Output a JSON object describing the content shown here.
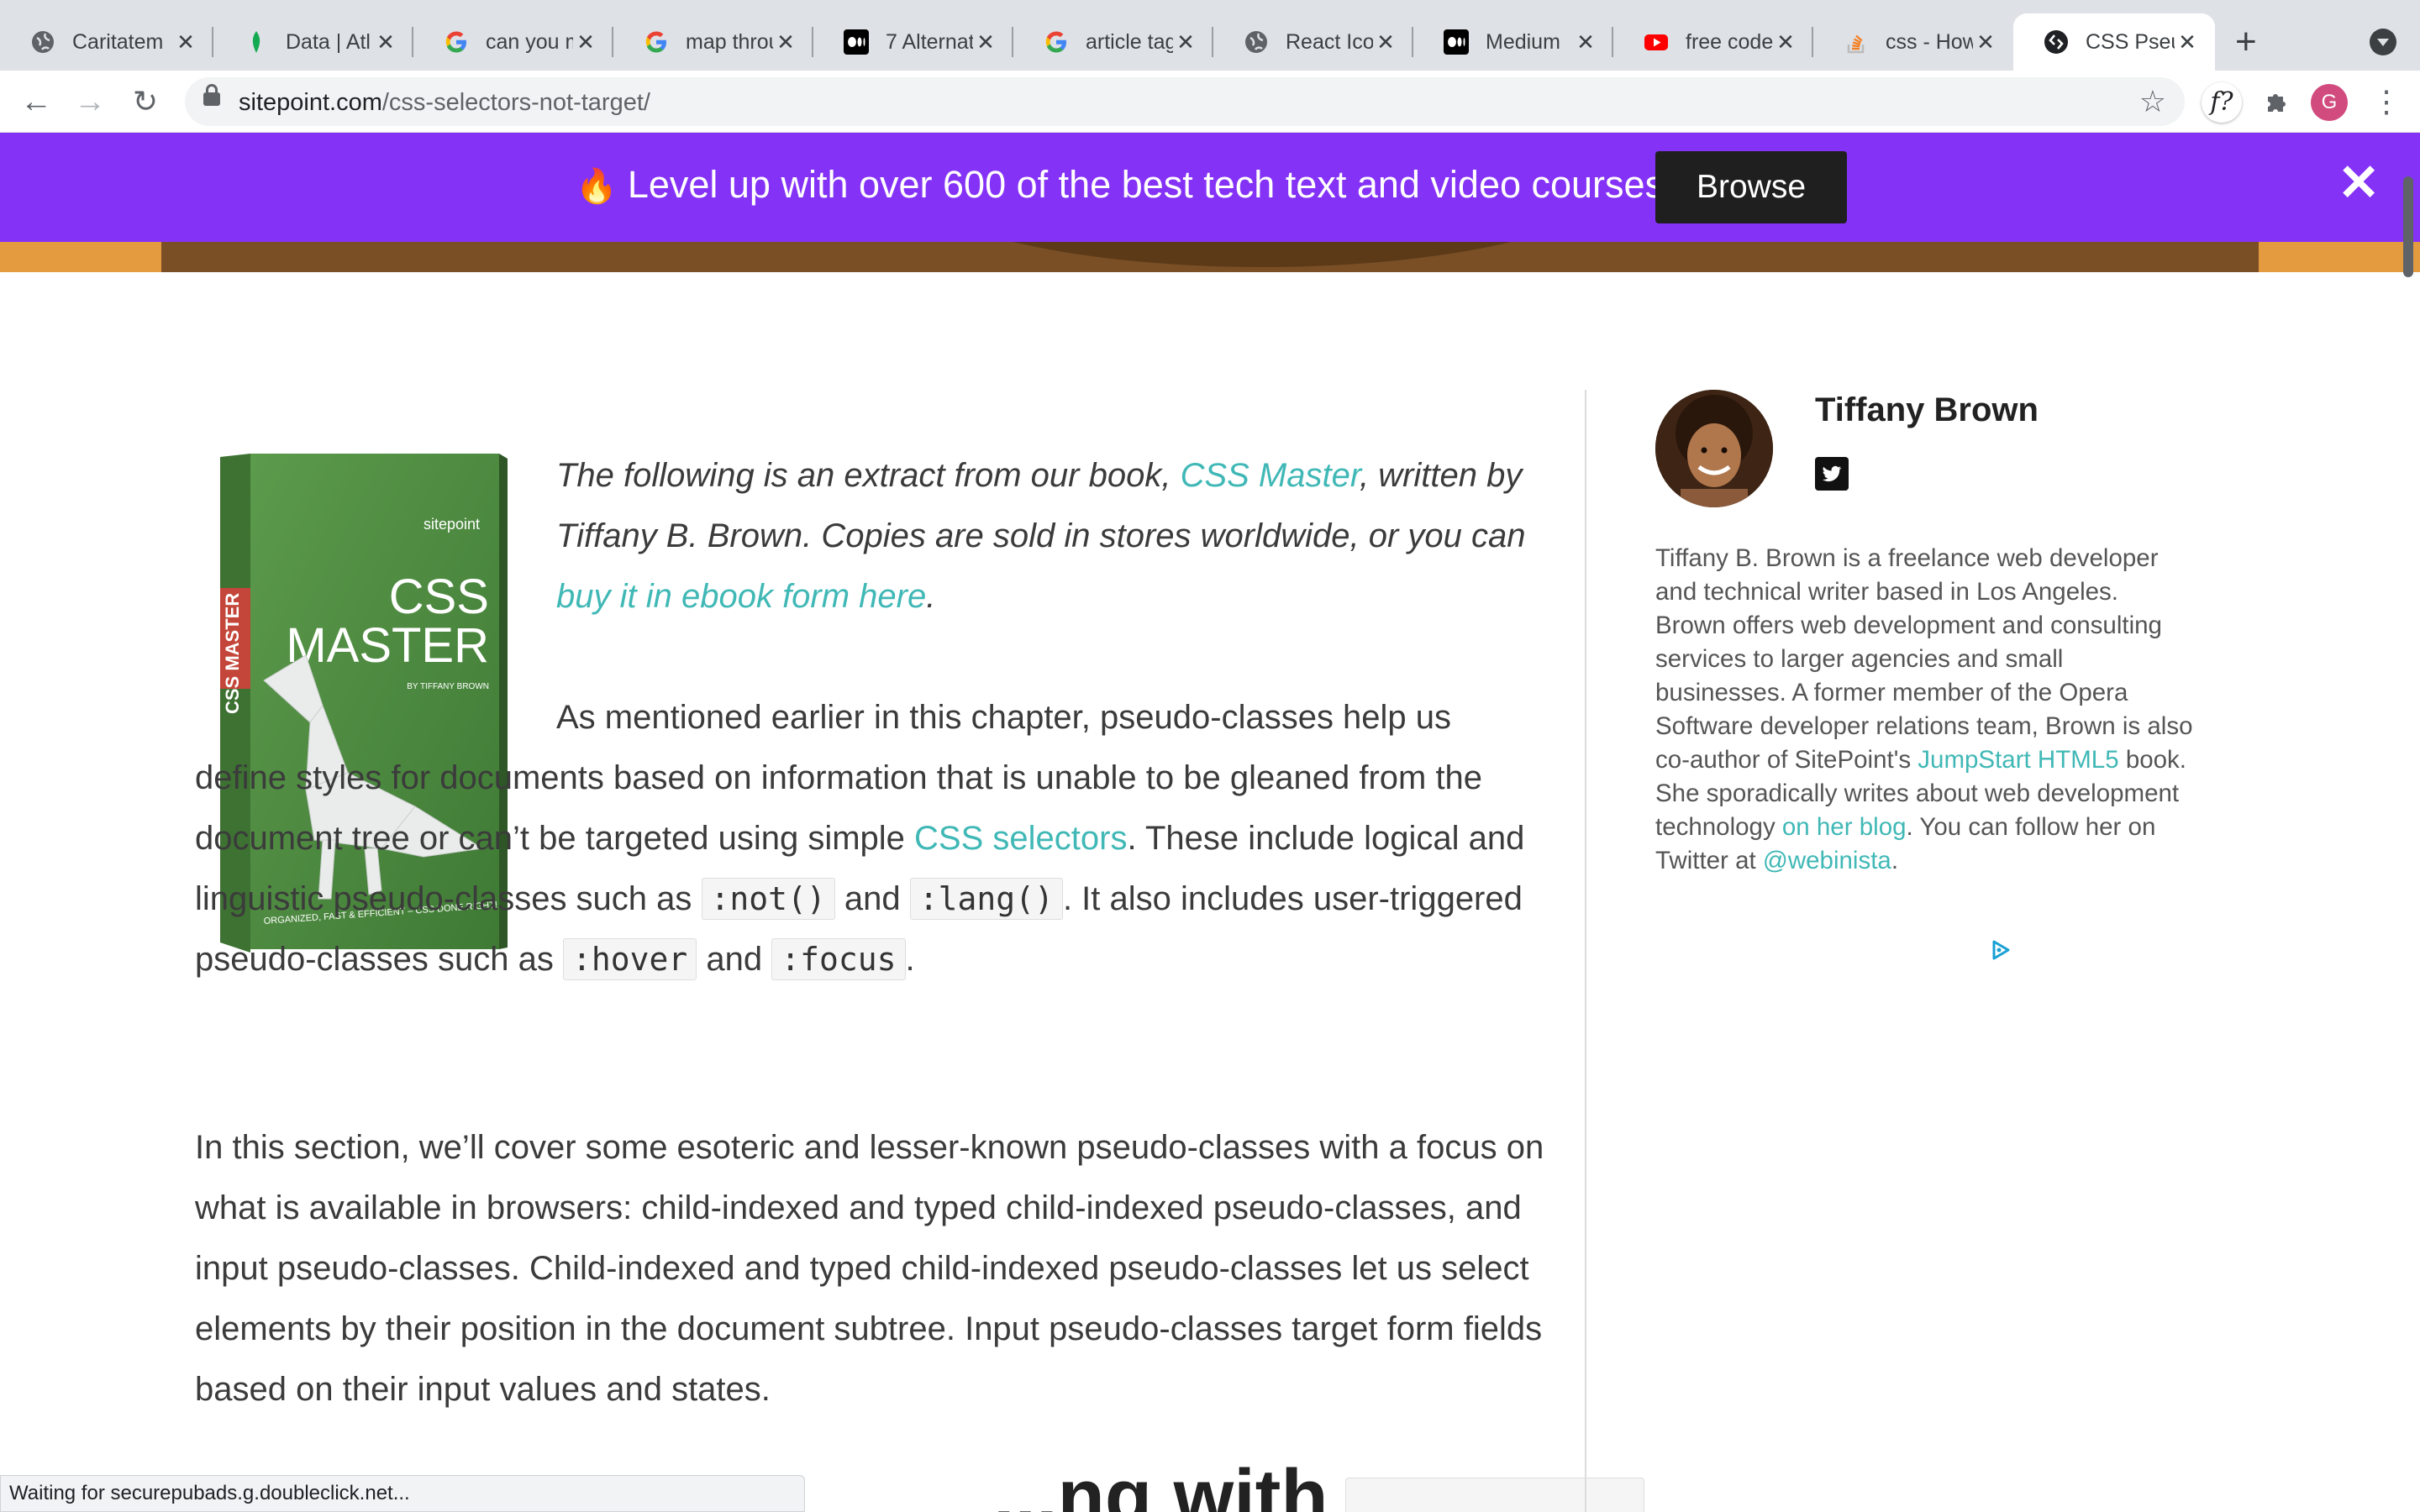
{
  "browser": {
    "tabs": [
      {
        "title": "Caritatem",
        "icon": "globe-icon"
      },
      {
        "title": "Data | Atl",
        "icon": "mongodb-leaf-icon"
      },
      {
        "title": "can you m",
        "icon": "google-g-icon"
      },
      {
        "title": "map throu",
        "icon": "google-g-icon"
      },
      {
        "title": "7 Alternat",
        "icon": "medium-icon"
      },
      {
        "title": "article tag",
        "icon": "google-g-icon"
      },
      {
        "title": "React Ico",
        "icon": "globe-icon"
      },
      {
        "title": "Medium",
        "icon": "medium-icon"
      },
      {
        "title": "free code",
        "icon": "youtube-icon"
      },
      {
        "title": "css - How",
        "icon": "stackoverflow-icon"
      },
      {
        "title": "CSS Pseu",
        "icon": "sitepoint-icon",
        "active": true
      }
    ],
    "url_host": "sitepoint.com",
    "url_path": "/css-selectors-not-target/",
    "profile_initial": "G",
    "extension_label": "f?"
  },
  "promo": {
    "icon": "🔥",
    "text": "Level up with over 600 of the best tech text and video courses",
    "button": "Browse"
  },
  "article": {
    "intro": {
      "t1": "The following is an extract from our book, ",
      "link1": "CSS Master",
      "t2": ", written by Tiffany B. Brown. Copies are sold in stores worldwide, or you can ",
      "link2": "buy it in ebook form here",
      "t3": "."
    },
    "p2": {
      "t1": "As mentioned earlier in this chapter, pseudo-classes help us define styles for documents based on information that is unable to be gleaned from the document tree or can’t be targeted using simple ",
      "link1": "CSS selectors",
      "t2": ". These include logical and linguistic pseudo-classes such as ",
      "code1": ":not()",
      "t3": " and ",
      "code2": ":lang()",
      "t4": ". It also includes user-triggered pseudo-classes such as ",
      "code3": ":hover",
      "t5": " and ",
      "code4": ":focus",
      "t6": "."
    },
    "p3": "In this section, we’ll cover some esoteric and lesser-known pseudo-classes with a focus on what is available in browsers: child-indexed and typed child-indexed pseudo-classes, and input pseudo-classes. Child-indexed and typed child-indexed pseudo-classes let us select elements by their position in the document subtree. Input pseudo-classes target form fields based on their input values and states.",
    "heading_peek": "...ng with",
    "book": {
      "brand": "sitepoint",
      "title_line1": "CSS",
      "title_line2": "MASTER",
      "byline": "BY TIFFANY BROWN",
      "tagline": "ORGANIZED, FAST & EFFICIENT – CSS DONE RIGHT!",
      "spine": "CSS MASTER"
    }
  },
  "author": {
    "name": "Tiffany Brown",
    "bio": {
      "t1": "Tiffany B. Brown is a freelance web developer and technical writer based in Los Angeles. Brown offers web development and consulting services to larger agencies and small businesses. A former member of the Opera Software developer relations team, Brown is also co-author of SitePoint's ",
      "link1": "JumpStart HTML5",
      "t2": " book. She sporadically writes about web development technology ",
      "link2": "on her blog",
      "t3": ". You can follow her on Twitter at ",
      "link3": "@webinista",
      "t4": "."
    }
  },
  "status_text": "Waiting for securepubads.g.doubleclick.net...",
  "colors": {
    "promo_bg": "#8532f7",
    "link": "#40b8b6",
    "book_green": "#4f8a3f",
    "book_red": "#c4463a"
  }
}
